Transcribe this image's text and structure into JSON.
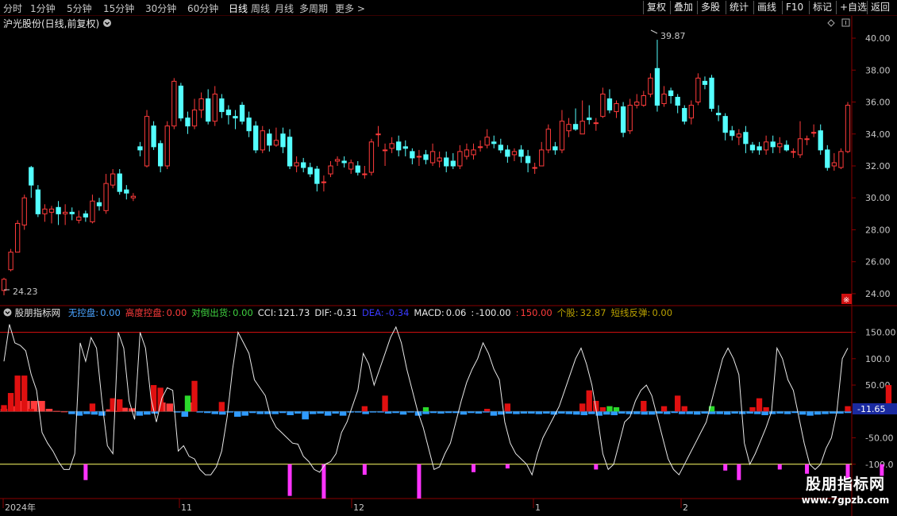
{
  "toolbar": {
    "periods": [
      "分时",
      "1分钟",
      "5分钟",
      "15分钟",
      "30分钟",
      "60分钟",
      "日线",
      "周线",
      "月线",
      "多周期",
      "更多 >"
    ],
    "active_period": "日线",
    "buttons": [
      "复权",
      "叠加",
      "多股",
      "统计",
      "画线",
      "F10",
      "标记",
      "+自选",
      "返回"
    ]
  },
  "stock": {
    "title": "沪光股份(日线,前复权)"
  },
  "price_axis": {
    "labels": [
      "40.00",
      "38.00",
      "36.00",
      "34.00",
      "32.00",
      "30.00",
      "28.00",
      "26.00",
      "24.00"
    ],
    "max_label": "39.87",
    "min_label": "24.23"
  },
  "indicator": {
    "name": "股朋指标网",
    "items": [
      {
        "label": "无控盘:",
        "value": "0.00",
        "color": "#4aa3ff"
      },
      {
        "label": "高度控盘:",
        "value": "0.00",
        "color": "#ff3b3b"
      },
      {
        "label": "对倒出货:",
        "value": "0.00",
        "color": "#3fd13f"
      },
      {
        "label": "CCI:",
        "value": "121.73",
        "color": "#e8e8e8"
      },
      {
        "label": "DIF:",
        "value": "-0.31",
        "color": "#e8e8e8"
      },
      {
        "label": "DEA:",
        "value": "-0.34",
        "color": "#3a3aff"
      },
      {
        "label": "MACD:",
        "value": "0.06",
        "color": "#e8e8e8"
      },
      {
        "label": ":",
        "value": "-100.00",
        "color": "#e8e8e8"
      },
      {
        "label": ":",
        "value": "150.00",
        "color": "#ff3b3b"
      },
      {
        "label": "个股:",
        "value": "32.87",
        "color": "#b8a000"
      },
      {
        "label": "短线反弹:",
        "value": "0.00",
        "color": "#b8a000"
      }
    ],
    "axis_labels": [
      "150.00",
      "100.0",
      "50.00",
      "-50.00",
      "-100.0"
    ],
    "current_label": "-11.65"
  },
  "date_axis": {
    "labels": [
      "2024年",
      "11",
      "12",
      "1",
      "2"
    ]
  },
  "watermark": {
    "title": "股朋指标网",
    "url": "www.7gpzb.com"
  },
  "chart_data": {
    "type": "candlestick",
    "ylim": [
      23.5,
      40.5
    ],
    "candles": [
      [
        24.2,
        24.9,
        25.0,
        23.9
      ],
      [
        25.5,
        26.6,
        26.8,
        25.4
      ],
      [
        26.6,
        28.4,
        28.6,
        26.6
      ],
      [
        28.3,
        30.0,
        30.2,
        28.0
      ],
      [
        31.9,
        30.8,
        32.0,
        30.0
      ],
      [
        30.5,
        29.0,
        30.8,
        28.8
      ],
      [
        29.0,
        29.3,
        29.6,
        28.5
      ],
      [
        29.1,
        29.3,
        29.5,
        28.4
      ],
      [
        29.4,
        29.0,
        29.8,
        28.3
      ],
      [
        29.0,
        29.1,
        29.6,
        28.3
      ],
      [
        29.1,
        29.0,
        29.4,
        28.6
      ],
      [
        28.6,
        28.8,
        29.2,
        28.4
      ],
      [
        29.0,
        28.8,
        29.2,
        28.5
      ],
      [
        28.5,
        29.8,
        30.2,
        28.4
      ],
      [
        29.7,
        29.5,
        30.0,
        29.2
      ],
      [
        29.2,
        30.9,
        31.5,
        29.0
      ],
      [
        30.8,
        31.5,
        31.8,
        30.6
      ],
      [
        31.5,
        30.4,
        31.8,
        30.2
      ],
      [
        30.5,
        30.3,
        30.8,
        29.9
      ],
      [
        30.0,
        30.1,
        30.3,
        29.8
      ],
      [
        33.2,
        33.0,
        33.5,
        32.6
      ],
      [
        32.0,
        35.1,
        35.5,
        31.9
      ],
      [
        34.5,
        33.2,
        34.8,
        33.0
      ],
      [
        33.4,
        32.0,
        33.6,
        31.6
      ],
      [
        32.0,
        34.5,
        34.8,
        31.8
      ],
      [
        34.5,
        37.3,
        37.5,
        34.3
      ],
      [
        37.0,
        35.0,
        37.2,
        34.8
      ],
      [
        35.0,
        34.5,
        35.4,
        34.0
      ],
      [
        34.5,
        35.5,
        36.2,
        34.3
      ],
      [
        35.5,
        36.2,
        36.6,
        35.0
      ],
      [
        36.2,
        34.8,
        36.8,
        34.6
      ],
      [
        34.8,
        36.5,
        37.0,
        34.5
      ],
      [
        36.2,
        35.4,
        36.5,
        35.0
      ],
      [
        35.5,
        35.2,
        35.8,
        34.6
      ],
      [
        35.1,
        35.0,
        35.5,
        34.3
      ],
      [
        35.8,
        34.8,
        36.0,
        34.6
      ],
      [
        35.0,
        34.2,
        35.4,
        33.8
      ],
      [
        34.5,
        33.0,
        34.8,
        32.8
      ],
      [
        33.0,
        34.2,
        34.5,
        32.8
      ],
      [
        34.0,
        33.3,
        34.3,
        32.9
      ],
      [
        33.3,
        33.6,
        34.4,
        33.2
      ],
      [
        34.0,
        33.2,
        34.4,
        32.8
      ],
      [
        33.8,
        32.0,
        34.3,
        31.8
      ],
      [
        32.0,
        32.2,
        32.6,
        31.6
      ],
      [
        32.2,
        31.9,
        32.5,
        31.6
      ],
      [
        31.9,
        31.5,
        32.2,
        31.3
      ],
      [
        31.8,
        30.9,
        32.0,
        30.4
      ],
      [
        31.0,
        31.0,
        31.4,
        30.4
      ],
      [
        31.5,
        32.0,
        32.3,
        31.3
      ],
      [
        32.3,
        32.4,
        32.6,
        32.0
      ],
      [
        32.3,
        32.2,
        32.6,
        31.9
      ],
      [
        31.8,
        32.2,
        32.4,
        31.5
      ],
      [
        32.0,
        31.6,
        32.3,
        31.4
      ],
      [
        31.5,
        31.5,
        32.0,
        31.2
      ],
      [
        31.6,
        33.5,
        33.7,
        31.4
      ],
      [
        34.0,
        34.0,
        34.5,
        33.2
      ],
      [
        33.0,
        33.0,
        33.4,
        32.0
      ],
      [
        33.1,
        33.4,
        33.8,
        32.8
      ],
      [
        33.5,
        33.0,
        33.9,
        32.6
      ],
      [
        33.2,
        33.1,
        33.6,
        32.6
      ],
      [
        32.9,
        32.5,
        33.1,
        32.1
      ],
      [
        32.6,
        32.6,
        33.0,
        32.0
      ],
      [
        32.7,
        32.4,
        33.0,
        32.1
      ],
      [
        32.2,
        32.9,
        33.4,
        32.0
      ],
      [
        32.3,
        32.5,
        32.9,
        31.9
      ],
      [
        32.5,
        32.0,
        32.9,
        31.6
      ],
      [
        32.3,
        32.0,
        32.8,
        31.8
      ],
      [
        32.0,
        32.9,
        33.3,
        31.8
      ],
      [
        32.6,
        33.0,
        33.4,
        32.4
      ],
      [
        32.7,
        33.0,
        33.4,
        32.4
      ],
      [
        33.2,
        33.2,
        33.6,
        32.9
      ],
      [
        33.3,
        33.8,
        34.3,
        33.1
      ],
      [
        33.5,
        33.4,
        33.9,
        33.1
      ],
      [
        33.3,
        33.0,
        33.7,
        32.8
      ],
      [
        33.0,
        32.6,
        33.3,
        32.2
      ],
      [
        32.7,
        32.9,
        33.1,
        32.3
      ],
      [
        33.0,
        32.6,
        33.3,
        32.2
      ],
      [
        32.6,
        32.2,
        33.0,
        31.6
      ],
      [
        31.9,
        31.9,
        32.2,
        31.5
      ],
      [
        32.0,
        33.0,
        33.5,
        32.0
      ],
      [
        33.0,
        34.3,
        34.6,
        32.8
      ],
      [
        33.2,
        33.0,
        33.5,
        32.7
      ],
      [
        33.0,
        34.8,
        35.5,
        32.8
      ],
      [
        34.2,
        34.6,
        35.0,
        33.8
      ],
      [
        34.6,
        34.3,
        35.6,
        34.2
      ],
      [
        34.0,
        34.8,
        36.1,
        34.0
      ],
      [
        35.0,
        34.9,
        35.8,
        34.6
      ],
      [
        34.7,
        34.7,
        35.0,
        34.2
      ],
      [
        35.1,
        36.5,
        36.9,
        35.0
      ],
      [
        36.2,
        35.5,
        36.8,
        35.3
      ],
      [
        35.4,
        35.9,
        36.1,
        35.0
      ],
      [
        35.7,
        34.1,
        36.0,
        33.8
      ],
      [
        34.2,
        35.8,
        36.2,
        34.0
      ],
      [
        35.8,
        36.0,
        36.5,
        35.6
      ],
      [
        35.8,
        36.4,
        36.7,
        35.7
      ],
      [
        36.5,
        37.5,
        37.8,
        36.3
      ],
      [
        38.1,
        35.8,
        39.9,
        35.4
      ],
      [
        35.9,
        36.5,
        37.0,
        35.7
      ],
      [
        36.7,
        36.4,
        36.9,
        35.9
      ],
      [
        36.3,
        35.8,
        36.5,
        35.3
      ],
      [
        35.6,
        34.8,
        35.8,
        34.6
      ],
      [
        35.0,
        35.8,
        36.1,
        34.6
      ],
      [
        36.0,
        37.5,
        37.8,
        35.8
      ],
      [
        37.3,
        37.1,
        37.6,
        36.8
      ],
      [
        37.5,
        35.6,
        37.7,
        35.4
      ],
      [
        35.3,
        35.2,
        35.8,
        34.8
      ],
      [
        35.1,
        34.1,
        35.3,
        33.6
      ],
      [
        34.2,
        33.9,
        34.5,
        33.6
      ],
      [
        33.8,
        34.0,
        34.3,
        33.3
      ],
      [
        34.1,
        33.4,
        34.5,
        32.8
      ],
      [
        33.3,
        33.0,
        33.5,
        32.8
      ],
      [
        33.2,
        33.0,
        33.5,
        32.7
      ],
      [
        33.0,
        33.5,
        33.9,
        32.7
      ],
      [
        33.5,
        33.2,
        33.9,
        32.8
      ],
      [
        33.2,
        33.4,
        33.8,
        32.8
      ],
      [
        33.3,
        33.0,
        33.6,
        32.9
      ],
      [
        32.9,
        32.9,
        33.1,
        32.5
      ],
      [
        32.7,
        33.7,
        34.8,
        32.5
      ],
      [
        33.7,
        33.7,
        33.9,
        33.3
      ],
      [
        34.1,
        34.1,
        34.6,
        33.8
      ],
      [
        34.2,
        33.0,
        34.6,
        32.7
      ],
      [
        33.0,
        31.9,
        33.3,
        31.7
      ],
      [
        32.0,
        32.2,
        32.8,
        31.7
      ],
      [
        31.9,
        32.9,
        33.1,
        31.8
      ],
      [
        32.9,
        35.8,
        36.0,
        32.8
      ]
    ],
    "indicator_ylim": [
      -162,
      190
    ],
    "cci_line": [
      95,
      165,
      130,
      125,
      115,
      70,
      40,
      -40,
      -60,
      -75,
      -95,
      -110,
      -110,
      -80,
      130,
      95,
      140,
      120,
      20,
      -65,
      -80,
      150,
      120,
      20,
      -15,
      150,
      120,
      25,
      -20,
      25,
      45,
      40,
      -75,
      -65,
      -85,
      -90,
      -110,
      -120,
      -120,
      -105,
      -75,
      -10,
      80,
      150,
      130,
      110,
      60,
      45,
      30,
      -10,
      -30,
      -40,
      -50,
      -60,
      -62,
      -85,
      -95,
      -110,
      -115,
      -100,
      -95,
      -80,
      -40,
      -20,
      10,
      40,
      110,
      90,
      50,
      80,
      110,
      140,
      160,
      130,
      80,
      40,
      0,
      -30,
      -70,
      -110,
      -105,
      -80,
      -60,
      -20,
      20,
      55,
      80,
      100,
      130,
      110,
      80,
      60,
      -20,
      -60,
      -80,
      -90,
      -100,
      -120,
      -80,
      -50,
      -30,
      -10,
      10,
      40,
      70,
      100,
      120,
      90,
      50,
      -10,
      -80,
      -110,
      -100,
      -60,
      -20,
      -10,
      20,
      40,
      50,
      30,
      -10,
      -50,
      -90,
      -110,
      -120,
      -100,
      -80,
      -60,
      -40,
      -20,
      20,
      60,
      100,
      120,
      100,
      70,
      -60,
      -100,
      -80,
      -55,
      -30,
      0,
      120,
      100,
      60,
      40,
      -10,
      -60,
      -100,
      -110,
      -100,
      -70,
      -50,
      0,
      100,
      120
    ],
    "macd_bars": [
      5,
      10,
      20,
      20,
      20,
      20,
      5,
      1,
      0,
      -5,
      -8,
      -5,
      -6,
      -8,
      4,
      1,
      7,
      6,
      -8,
      -6,
      -4,
      17,
      15,
      -2,
      -10,
      17,
      -2,
      -3,
      -5,
      -6,
      -2,
      -10,
      -8,
      -3,
      -5,
      -5,
      -5,
      -3,
      -7,
      -4,
      -15,
      -5,
      -4,
      -8,
      -4,
      -8,
      -2,
      -2,
      -5,
      -2,
      -2,
      -4,
      -3,
      -6,
      -2,
      -8,
      -5,
      -3,
      -4,
      -3,
      -3,
      -6,
      -3,
      -4,
      -2,
      -8,
      -6,
      -4,
      -5,
      -4,
      -4,
      -5,
      -4,
      -6,
      -4,
      -5,
      -6,
      -7,
      -5,
      -8,
      -6,
      -7,
      -4,
      -5,
      -5,
      -6,
      -6,
      -4,
      -5,
      -3,
      -5,
      -5,
      -6,
      -4,
      -5,
      -5,
      -6,
      -4,
      -5,
      -4,
      -5,
      -7,
      -5,
      -4,
      -5,
      -3,
      -6,
      -8,
      -6,
      -5,
      -4,
      -4,
      -3
    ],
    "vert_bars": [
      {
        "i": 0,
        "v": 12,
        "c": "red"
      },
      {
        "i": 1,
        "v": 35,
        "c": "red"
      },
      {
        "i": 2,
        "v": 68,
        "c": "red"
      },
      {
        "i": 3,
        "v": 68,
        "c": "red"
      },
      {
        "i": 4,
        "v": 5,
        "c": "red"
      },
      {
        "i": 13,
        "v": 15,
        "c": "red"
      },
      {
        "i": 16,
        "v": 25,
        "c": "red"
      },
      {
        "i": 17,
        "v": 23,
        "c": "red"
      },
      {
        "i": 22,
        "v": 50,
        "c": "red"
      },
      {
        "i": 23,
        "v": 45,
        "c": "red"
      },
      {
        "i": 27,
        "v": 30,
        "c": "green"
      },
      {
        "i": 28,
        "v": 58,
        "c": "red"
      },
      {
        "i": 32,
        "v": 18,
        "c": "red"
      },
      {
        "i": 53,
        "v": 10,
        "c": "red"
      },
      {
        "i": 56,
        "v": 30,
        "c": "red"
      },
      {
        "i": 62,
        "v": 8,
        "c": "green"
      },
      {
        "i": 71,
        "v": 5,
        "c": "red"
      },
      {
        "i": 74,
        "v": 15,
        "c": "red"
      },
      {
        "i": 85,
        "v": 15,
        "c": "red"
      },
      {
        "i": 86,
        "v": 40,
        "c": "red"
      },
      {
        "i": 87,
        "v": 20,
        "c": "red"
      },
      {
        "i": 88,
        "v": 8,
        "c": "red"
      },
      {
        "i": 89,
        "v": 10,
        "c": "green"
      },
      {
        "i": 90,
        "v": 8,
        "c": "green"
      },
      {
        "i": 94,
        "v": 20,
        "c": "red"
      },
      {
        "i": 97,
        "v": 10,
        "c": "red"
      },
      {
        "i": 99,
        "v": 30,
        "c": "red"
      },
      {
        "i": 100,
        "v": 10,
        "c": "red"
      },
      {
        "i": 104,
        "v": 10,
        "c": "green"
      },
      {
        "i": 110,
        "v": 8,
        "c": "red"
      },
      {
        "i": 111,
        "v": 25,
        "c": "red"
      },
      {
        "i": 112,
        "v": 8,
        "c": "red"
      },
      {
        "i": 124,
        "v": 10,
        "c": "red"
      },
      {
        "i": 130,
        "v": 50,
        "c": "red"
      }
    ],
    "magenta_bars": [
      {
        "i": 12,
        "v": -130
      },
      {
        "i": 42,
        "v": -160
      },
      {
        "i": 47,
        "v": -165
      },
      {
        "i": 53,
        "v": -120
      },
      {
        "i": 61,
        "v": -165
      },
      {
        "i": 69,
        "v": -115
      },
      {
        "i": 74,
        "v": -108
      },
      {
        "i": 87,
        "v": -110
      },
      {
        "i": 106,
        "v": -112
      },
      {
        "i": 108,
        "v": -130
      },
      {
        "i": 114,
        "v": -110
      },
      {
        "i": 118,
        "v": -118
      },
      {
        "i": 124,
        "v": -128
      },
      {
        "i": 129,
        "v": -122
      }
    ],
    "ref_lines": [
      150,
      -100
    ]
  }
}
